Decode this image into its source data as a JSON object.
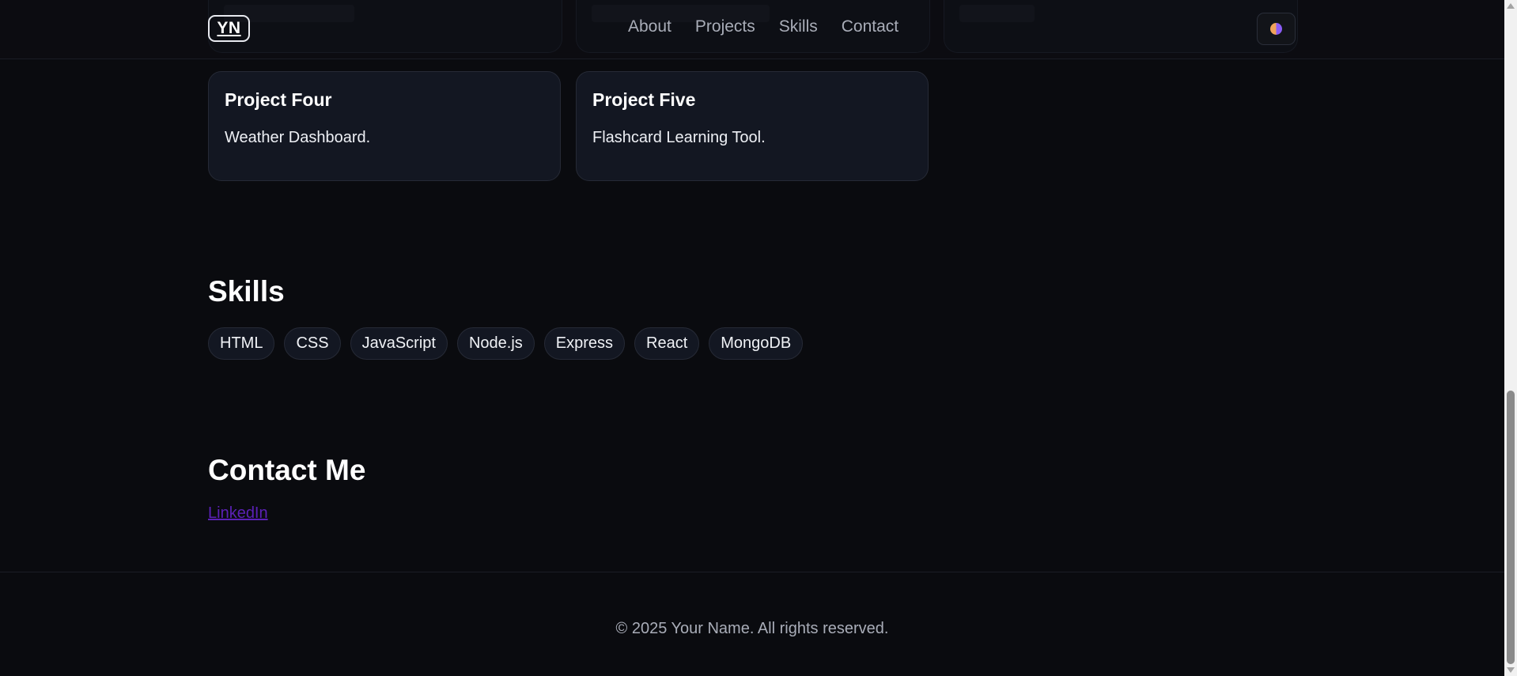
{
  "header": {
    "logo": "YN",
    "nav": [
      {
        "label": "About"
      },
      {
        "label": "Projects"
      },
      {
        "label": "Skills"
      },
      {
        "label": "Contact"
      }
    ],
    "theme_toggle_icon": "theme-toggle-icon"
  },
  "projects": [
    {
      "title": "Project Four",
      "description": "Weather Dashboard."
    },
    {
      "title": "Project Five",
      "description": "Flashcard Learning Tool."
    }
  ],
  "skills": {
    "title": "Skills",
    "items": [
      "HTML",
      "CSS",
      "JavaScript",
      "Node.js",
      "Express",
      "React",
      "MongoDB"
    ]
  },
  "contact": {
    "title": "Contact Me",
    "link_label": "LinkedIn"
  },
  "footer": {
    "text": "© 2025 Your Name. All rights reserved."
  },
  "colors": {
    "background": "#0a0b0f",
    "card": "#131722",
    "link": "#5b21b6",
    "muted_text": "#a9adb8"
  }
}
